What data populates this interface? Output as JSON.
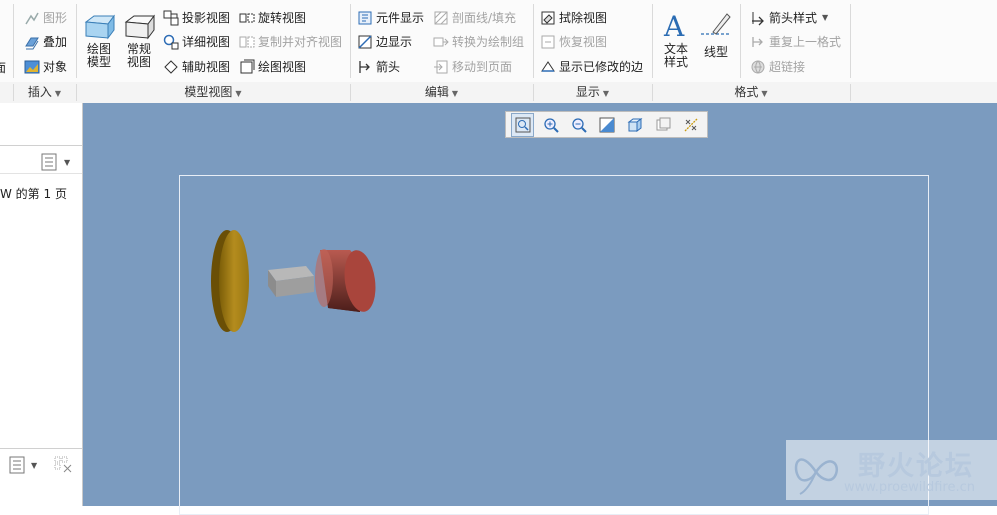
{
  "ribbon": {
    "insert": {
      "items": [
        "图形",
        "叠加",
        "对象"
      ],
      "partial_label": "面"
    },
    "model_views": {
      "big": [
        "绘图\n模型",
        "常规\n视图"
      ],
      "col1": [
        "投影视图",
        "详细视图",
        "辅助视图"
      ],
      "col2": [
        "旋转视图",
        "复制并对齐视图",
        "绘图视图"
      ]
    },
    "edit": {
      "col1": [
        "元件显示",
        "边显示",
        "箭头"
      ],
      "col2": [
        "剖面线/填充",
        "转换为绘制组",
        "移动到页面"
      ]
    },
    "display": {
      "col1": [
        "拭除视图",
        "恢复视图",
        "显示已修改的边"
      ]
    },
    "format": {
      "big": [
        "文本\n样式",
        "线型"
      ],
      "col1": [
        "箭头样式",
        "重复上一格式",
        "超链接"
      ]
    }
  },
  "group_labels": [
    "插入",
    "模型视图",
    "编辑",
    "显示",
    "格式"
  ],
  "left_panel": {
    "page_text": "W 的第 1 页"
  },
  "view_toolbar": {
    "buttons": [
      "refit-icon",
      "zoom-in-icon",
      "zoom-out-icon",
      "repaint-icon",
      "display-style-icon",
      "saved-orientations-icon",
      "datum-display-icon"
    ]
  },
  "watermark": {
    "title": "野火论坛",
    "url": "www.proewildfire.cn"
  },
  "colors": {
    "canvas": "#7b9bbf",
    "disc": "#b08a1c",
    "block": "#9a9a9a",
    "cylinder": "#a84a42"
  }
}
